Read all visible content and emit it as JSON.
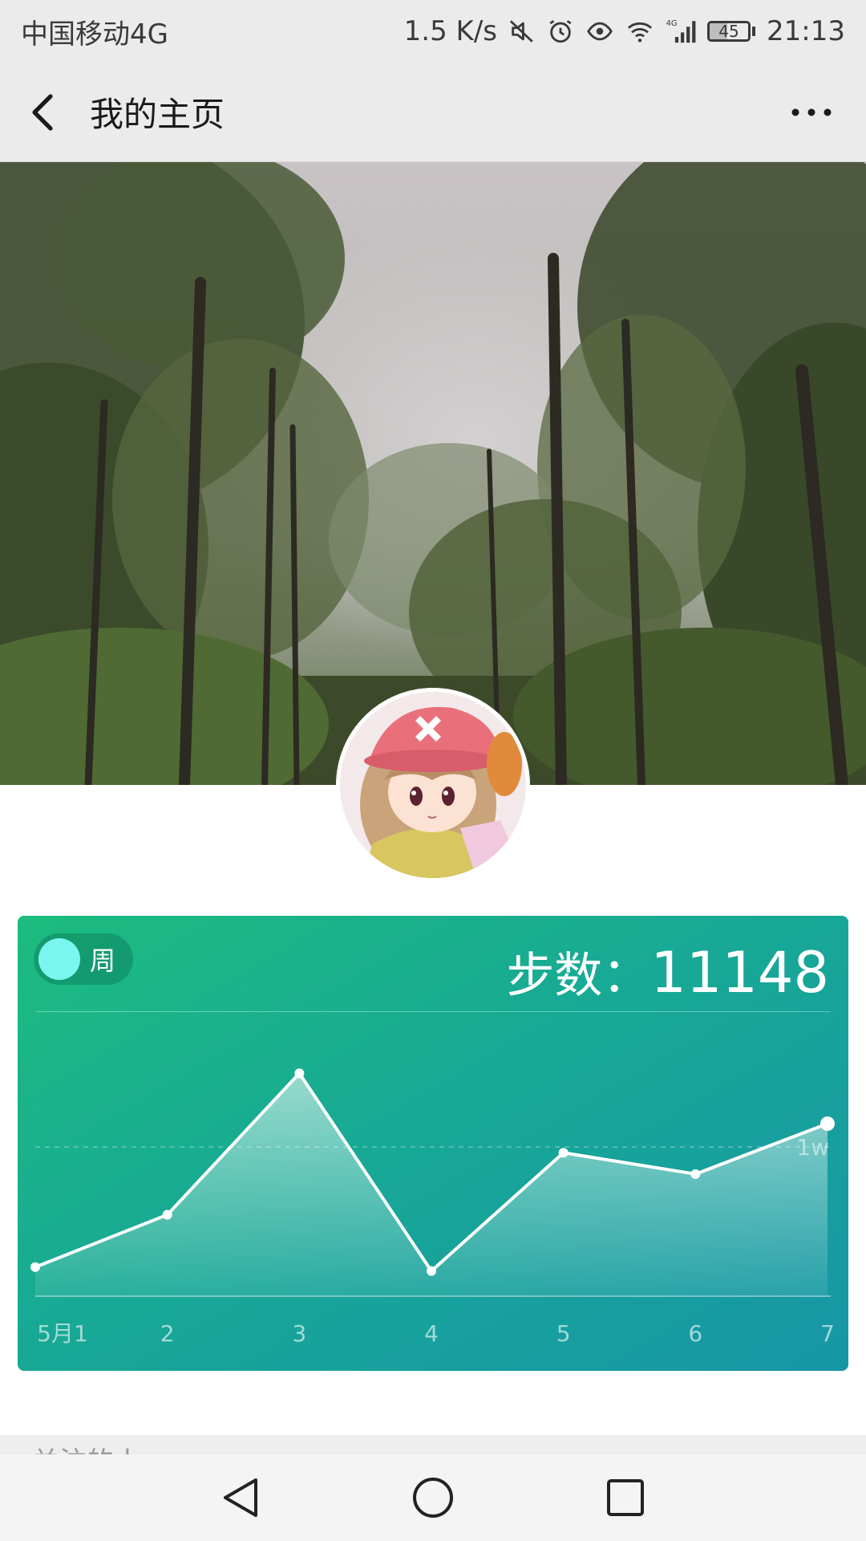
{
  "status_bar": {
    "carrier": "中国移动4G",
    "net_speed": "1.5 K/s",
    "battery_level": 45,
    "battery_text": "45",
    "time": "21:13",
    "icons": [
      "mute-icon",
      "alarm-icon",
      "eye-icon",
      "wifi-icon",
      "signal-icon",
      "battery-icon"
    ]
  },
  "header": {
    "title": "我的主页",
    "back_icon": "chevron-left-icon",
    "more_icon": "more-dots-icon"
  },
  "cover": {
    "description_icon": "forest-cover-image"
  },
  "avatar": {
    "icon": "anime-avatar"
  },
  "steps_card": {
    "period_label": "周",
    "steps_label": "步数：",
    "steps_value": "11148",
    "colors": {
      "gradient_start": "#1dbc7f",
      "gradient_end": "#1796a6",
      "toggle_knob": "#7af6ef"
    }
  },
  "chart_data": {
    "type": "area",
    "categories": [
      "5月1",
      "2",
      "3",
      "4",
      "5",
      "6",
      "7"
    ],
    "values": [
      1500,
      4200,
      11500,
      1300,
      7400,
      6300,
      8900
    ],
    "reference_line": {
      "label": "1w",
      "value": 7700
    },
    "ylim": [
      0,
      13000
    ],
    "grid": false,
    "legend": "none"
  },
  "bottom": {
    "peek_text": "关注的人"
  },
  "system_nav": {
    "back_icon": "triangle-back-icon",
    "home_icon": "circle-home-icon",
    "recents_icon": "square-recents-icon"
  }
}
